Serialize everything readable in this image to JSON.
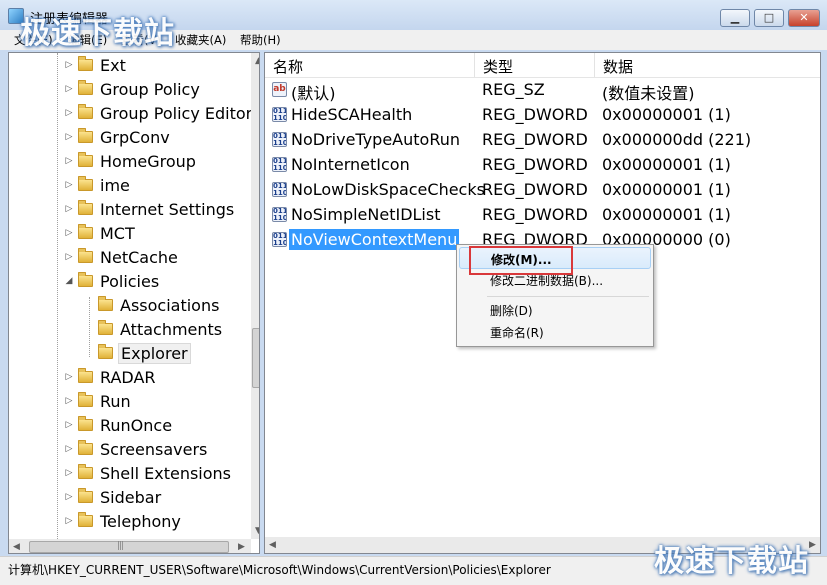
{
  "window": {
    "title": "注册表编辑器",
    "minimize": "▁",
    "maximize": "□",
    "close": "✕"
  },
  "menu": [
    "文件(F)",
    "编辑(E)",
    "查看(V)",
    "收藏夹(A)",
    "帮助(H)"
  ],
  "tree": [
    {
      "label": "Ext",
      "indent": 0
    },
    {
      "label": "Group Policy",
      "indent": 0
    },
    {
      "label": "Group Policy Editor",
      "indent": 0
    },
    {
      "label": "GrpConv",
      "indent": 0
    },
    {
      "label": "HomeGroup",
      "indent": 0
    },
    {
      "label": "ime",
      "indent": 0
    },
    {
      "label": "Internet Settings",
      "indent": 0
    },
    {
      "label": "MCT",
      "indent": 0
    },
    {
      "label": "NetCache",
      "indent": 0
    },
    {
      "label": "Policies",
      "indent": 0,
      "expanded": true
    },
    {
      "label": "Associations",
      "indent": 1
    },
    {
      "label": "Attachments",
      "indent": 1
    },
    {
      "label": "Explorer",
      "indent": 1,
      "selected": true
    },
    {
      "label": "RADAR",
      "indent": 0
    },
    {
      "label": "Run",
      "indent": 0
    },
    {
      "label": "RunOnce",
      "indent": 0
    },
    {
      "label": "Screensavers",
      "indent": 0
    },
    {
      "label": "Shell Extensions",
      "indent": 0
    },
    {
      "label": "Sidebar",
      "indent": 0
    },
    {
      "label": "Telephony",
      "indent": 0
    }
  ],
  "columns": {
    "name": "名称",
    "type": "类型",
    "data": "数据"
  },
  "values": [
    {
      "name": "(默认)",
      "type": "REG_SZ",
      "data": "(数值未设置)",
      "icon": "ab"
    },
    {
      "name": "HideSCAHealth",
      "type": "REG_DWORD",
      "data": "0x00000001 (1)",
      "icon": "dword"
    },
    {
      "name": "NoDriveTypeAutoRun",
      "type": "REG_DWORD",
      "data": "0x000000dd (221)",
      "icon": "dword"
    },
    {
      "name": "NoInternetIcon",
      "type": "REG_DWORD",
      "data": "0x00000001 (1)",
      "icon": "dword"
    },
    {
      "name": "NoLowDiskSpaceChecks",
      "type": "REG_DWORD",
      "data": "0x00000001 (1)",
      "icon": "dword"
    },
    {
      "name": "NoSimpleNetIDList",
      "type": "REG_DWORD",
      "data": "0x00000001 (1)",
      "icon": "dword"
    },
    {
      "name": "NoViewContextMenu",
      "type": "REG_DWORD",
      "data": "0x00000000 (0)",
      "icon": "dword",
      "selected": true
    }
  ],
  "context_menu": {
    "modify": "修改(M)...",
    "modify_binary": "修改二进制数据(B)...",
    "delete": "删除(D)",
    "rename": "重命名(R)"
  },
  "status": "计算机\\HKEY_CURRENT_USER\\Software\\Microsoft\\Windows\\CurrentVersion\\Policies\\Explorer",
  "watermark": "极速下载站"
}
